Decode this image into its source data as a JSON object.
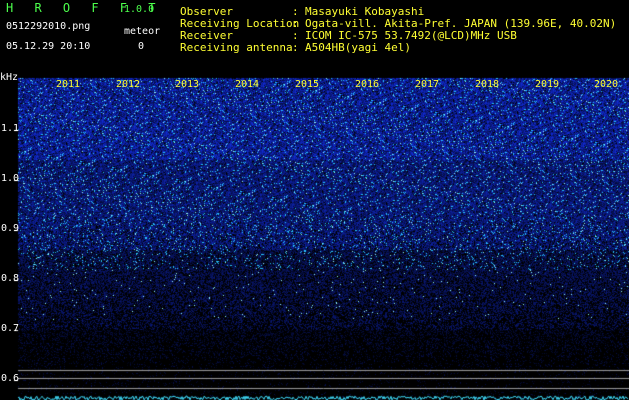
{
  "app": {
    "title": "H R O F F T",
    "version": "1.0.0"
  },
  "capture": {
    "file_name": "0512292010.png",
    "datetime": "05.12.29 20:10",
    "meteor_label": "meteor",
    "meteor_count": "0"
  },
  "info": [
    {
      "label": "Observer",
      "value": "Masayuki Kobayashi"
    },
    {
      "label": "Receiving Location",
      "value": "Ogata-vill. Akita-Pref. JAPAN (139.96E, 40.02N)"
    },
    {
      "label": "Receiver",
      "value": "ICOM IC-575 53.7492(@LCD)MHz USB"
    },
    {
      "label": "Receiving antenna",
      "value": "A504HB(yagi 4el)"
    }
  ],
  "info_colon": ":",
  "axis": {
    "unit": "kHz",
    "freq_ticks": [
      "1.1",
      "1.0",
      "0.9",
      "0.8",
      "0.7",
      "0.6"
    ],
    "years": [
      "2011",
      "2012",
      "2013",
      "2014",
      "2015",
      "2016",
      "2017",
      "2018",
      "2019",
      "2020"
    ]
  },
  "colors": {
    "title_green": "#4cff4c",
    "label_yellow": "#ffff33",
    "text_white": "#ffffff",
    "noise_blue": "#2030c0",
    "noise_cyan": "#40e0ff"
  }
}
